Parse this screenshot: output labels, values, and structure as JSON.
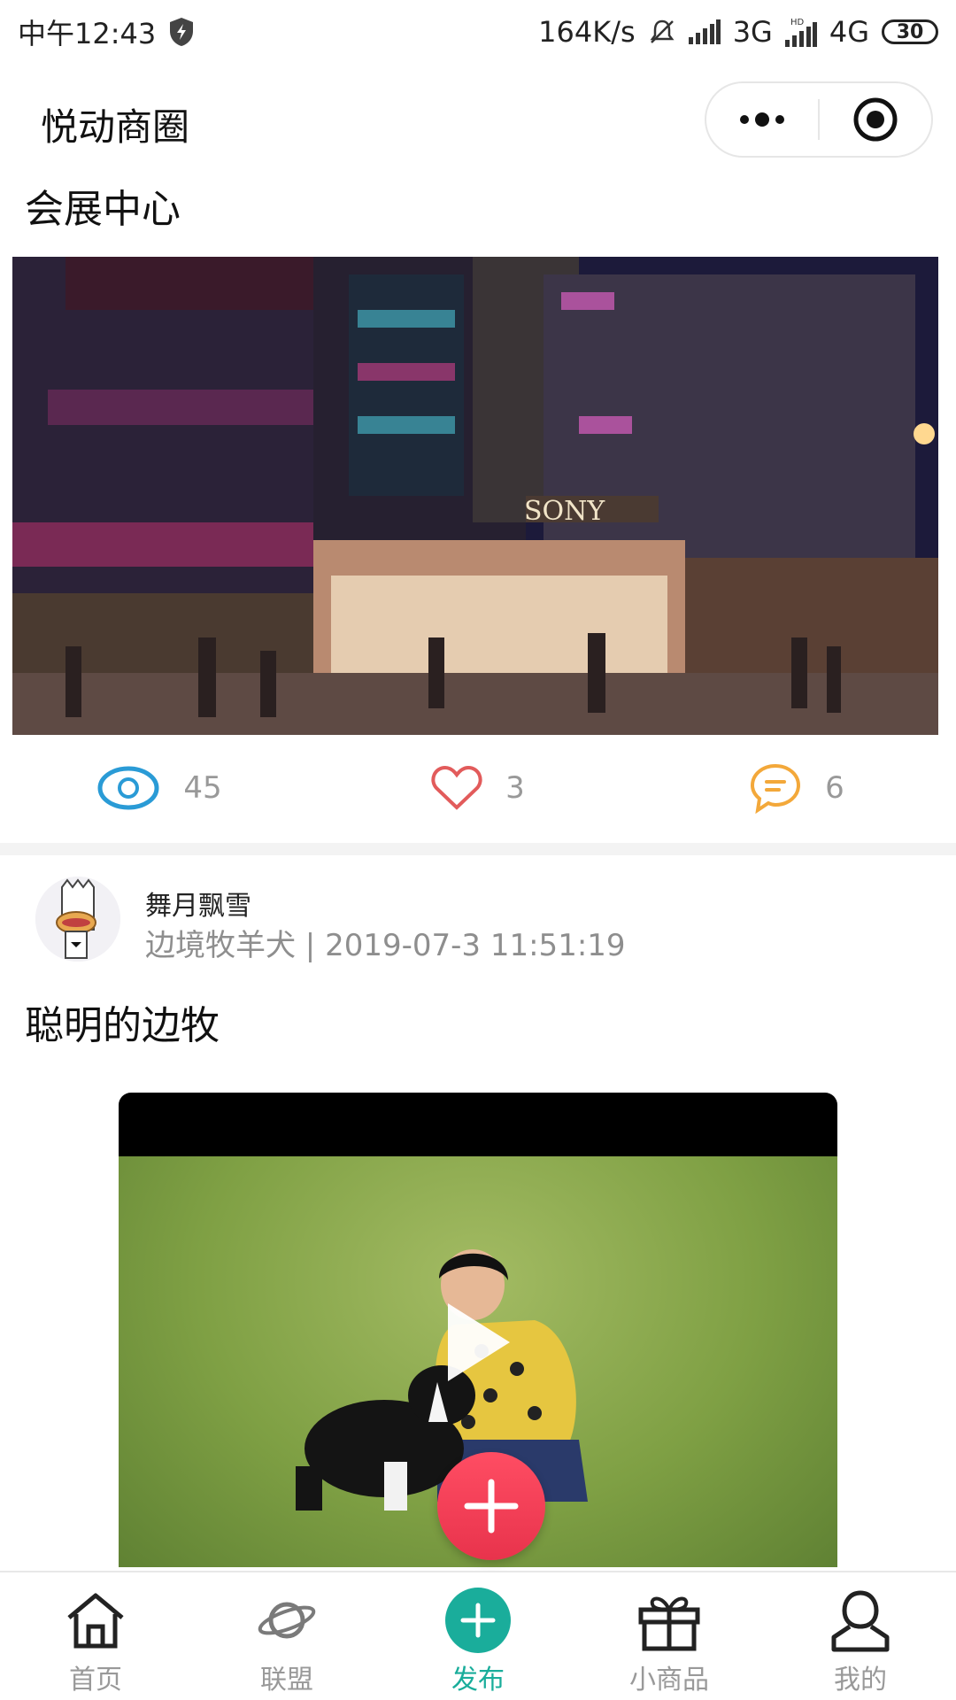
{
  "status_bar": {
    "time": "中午12:43",
    "network_speed": "164K/s",
    "network_3g": "3G",
    "network_4g": "4G",
    "hd_badge": "HD",
    "battery": "30"
  },
  "nav": {
    "title": "悦动商圈"
  },
  "posts": [
    {
      "title": "会展中心",
      "stats": {
        "views": "45",
        "likes": "3",
        "comments": "6"
      }
    },
    {
      "author": "舞月飘雪",
      "meta": "边境牧羊犬 | 2019-07-3 11:51:19",
      "title": "聪明的边牧"
    }
  ],
  "tabs": [
    {
      "label": "首页",
      "icon": "home-icon"
    },
    {
      "label": "联盟",
      "icon": "planet-icon"
    },
    {
      "label": "发布",
      "icon": "plus-icon",
      "active": true
    },
    {
      "label": "小商品",
      "icon": "gift-icon"
    },
    {
      "label": "我的",
      "icon": "user-icon"
    }
  ],
  "colors": {
    "accent": "#1aad9b",
    "fab": "#f03e55",
    "view_icon": "#2a9bd6",
    "like_icon": "#e25b5b",
    "comment_icon": "#f3a83a"
  }
}
